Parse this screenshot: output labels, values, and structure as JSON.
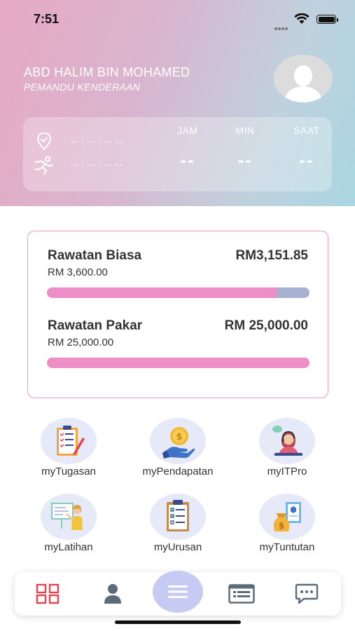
{
  "status_bar": {
    "time": "7:51"
  },
  "profile": {
    "name": "ABD HALIM BIN MOHAMED",
    "role": "PEMANDU KENDERAAN"
  },
  "attendance": {
    "check_in_time": "-- : -- : -- --",
    "check_out_time": "-- : -- : -- --",
    "columns": [
      {
        "label": "JAM",
        "value": "--"
      },
      {
        "label": "MIN",
        "value": "--"
      },
      {
        "label": "SAAT",
        "value": "--"
      }
    ]
  },
  "coverage": {
    "items": [
      {
        "title": "Rawatan Biasa",
        "balance": "RM3,151.85",
        "limit": "RM 3,600.00",
        "fill_fraction": 0.875
      },
      {
        "title": "Rawatan Pakar",
        "balance": "RM 25,000.00",
        "limit": "RM 25,000.00",
        "fill_fraction": 1.0
      }
    ],
    "colors": {
      "fill": "#ee8ec9",
      "track": "#a8b0d2",
      "border": "#ee9ac8"
    }
  },
  "apps": [
    {
      "label": "myTugasan",
      "icon": "clipboard-checklist-icon"
    },
    {
      "label": "myPendapatan",
      "icon": "coin-hand-icon"
    },
    {
      "label": "myITPro",
      "icon": "support-agent-icon"
    },
    {
      "label": "myLatihan",
      "icon": "training-board-icon"
    },
    {
      "label": "myUrusan",
      "icon": "checklist-icon"
    },
    {
      "label": "myTuntutan",
      "icon": "money-bag-document-icon"
    }
  ],
  "bottom_nav": {
    "items": [
      "grid-icon",
      "user-icon",
      "menu-icon",
      "list-card-icon",
      "chat-icon"
    ],
    "colors": {
      "grid": "#e0454f",
      "default": "#5c6b7a",
      "center_bg": "#c6cbf3"
    }
  }
}
